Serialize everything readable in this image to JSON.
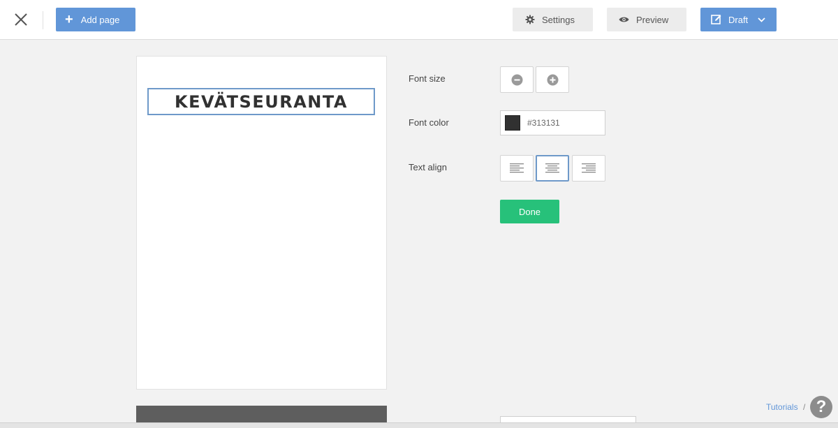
{
  "topbar": {
    "close_icon": "close-icon",
    "add_page_label": "Add page",
    "settings_label": "Settings",
    "preview_label": "Preview",
    "draft_label": "Draft",
    "accent_color": "#6196d8"
  },
  "page": {
    "title_text": "KEVÄTSEURANTA"
  },
  "properties": {
    "font_size_label": "Font size",
    "font_color_label": "Font color",
    "font_color_value": "#313131",
    "text_align_label": "Text align",
    "text_align_selected": "center",
    "done_label": "Done",
    "done_color": "#27c17a"
  },
  "footer": {
    "tutorials_label": "Tutorials",
    "separator": "/",
    "help_symbol": "?"
  }
}
